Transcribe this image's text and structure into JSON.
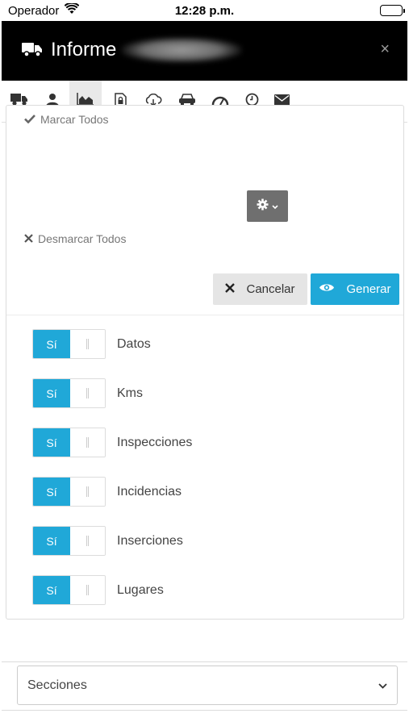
{
  "status_bar": {
    "carrier": "Operador",
    "time": "12:28 p.m."
  },
  "header": {
    "title": "Informe",
    "close_label": "×"
  },
  "tabs": [
    {
      "icon": "truck-icon"
    },
    {
      "icon": "user-icon"
    },
    {
      "icon": "area-chart-icon",
      "active": true
    },
    {
      "icon": "document-lock-icon"
    },
    {
      "icon": "cloud-download-icon"
    },
    {
      "icon": "car-icon"
    },
    {
      "icon": "speedometer-icon"
    },
    {
      "icon": "clock-icon"
    },
    {
      "icon": "envelope-icon"
    }
  ],
  "actions": {
    "select_all": "Marcar Todos",
    "deselect_all": "Desmarcar Todos",
    "cancel": "Cancelar",
    "generate": "Generar"
  },
  "toggles": [
    {
      "label": "Datos",
      "on_text": "Sí",
      "on": true
    },
    {
      "label": "Kms",
      "on_text": "Sí",
      "on": true
    },
    {
      "label": "Inspecciones",
      "on_text": "Sí",
      "on": true
    },
    {
      "label": "Incidencias",
      "on_text": "Sí",
      "on": true
    },
    {
      "label": "Inserciones",
      "on_text": "Sí",
      "on": true
    },
    {
      "label": "Lugares",
      "on_text": "Sí",
      "on": true
    }
  ],
  "sections_select": {
    "value": "Secciones"
  },
  "colors": {
    "accent": "#20a8d8",
    "header_bg": "#000000",
    "gear_bg": "#6f6f6f"
  }
}
